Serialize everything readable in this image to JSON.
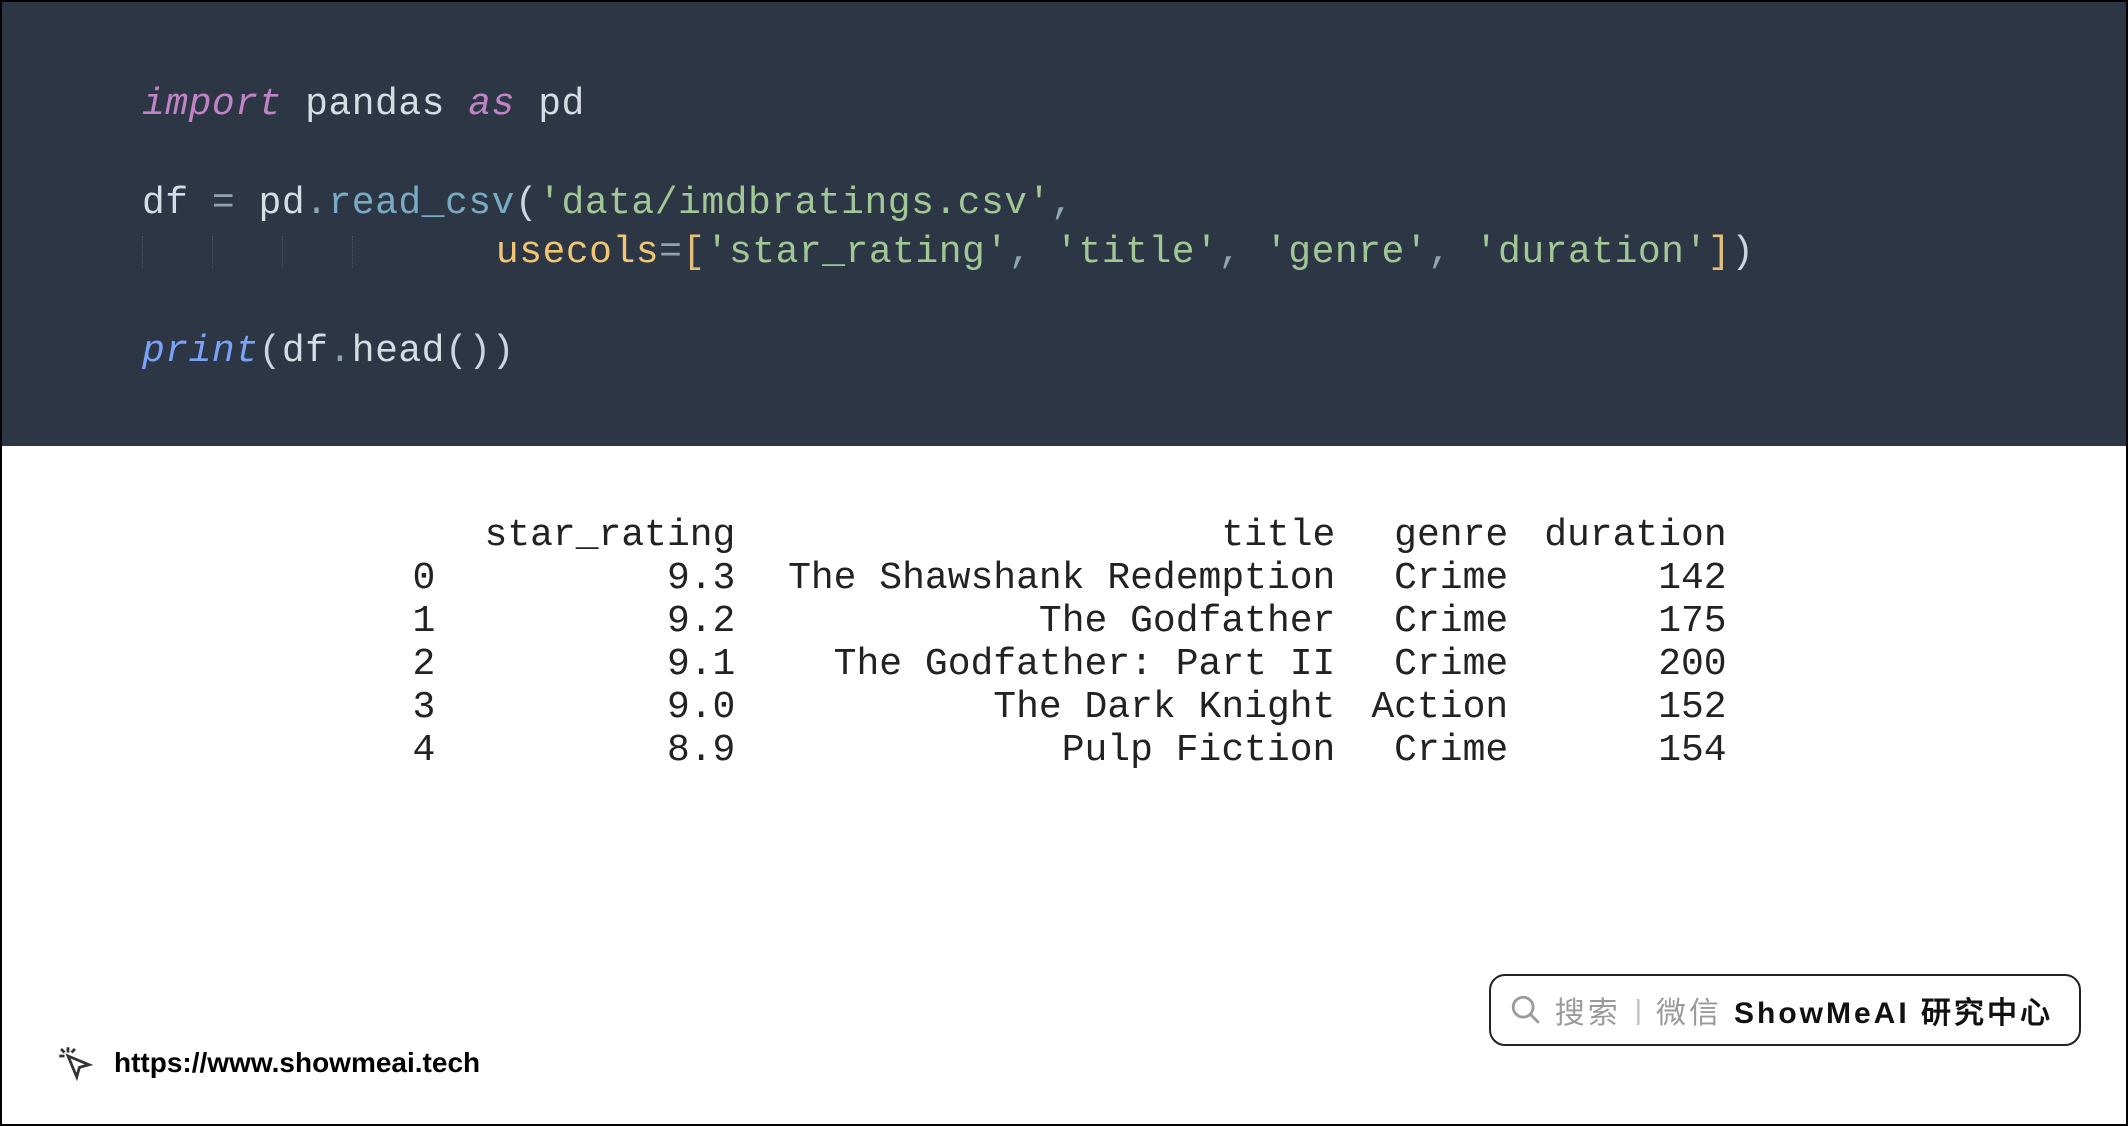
{
  "code": {
    "l1": {
      "kw1": "import",
      "mod": "pandas",
      "kw2": "as",
      "alias": "pd"
    },
    "l3": {
      "lhs": "df",
      "eq": "=",
      "obj": "pd",
      "dot": ".",
      "fn": "read_csv",
      "open": "(",
      "arg1": "'data/imdbratings.csv'",
      "comma": ","
    },
    "l4": {
      "param": "usecols",
      "eq2": "=",
      "lb": "[",
      "c1": "'star_rating'",
      "sep1": ", ",
      "c2": "'title'",
      "sep2": ", ",
      "c3": "'genre'",
      "sep3": ", ",
      "c4": "'duration'",
      "rb": "]",
      "close": ")"
    },
    "l6": {
      "print": "print",
      "open": "(",
      "obj": "df",
      "dot": ".",
      "fn": "head",
      "open2": "(",
      "close2": ")",
      "close": ")"
    }
  },
  "output": {
    "headers": {
      "idx": "",
      "c0": "star_rating",
      "c1": "title",
      "c2": "genre",
      "c3": "duration"
    },
    "rows": [
      {
        "idx": "0",
        "star_rating": "9.3",
        "title": "The Shawshank Redemption",
        "genre": "Crime",
        "duration": "142"
      },
      {
        "idx": "1",
        "star_rating": "9.2",
        "title": "The Godfather",
        "genre": "Crime",
        "duration": "175"
      },
      {
        "idx": "2",
        "star_rating": "9.1",
        "title": "The Godfather: Part II",
        "genre": "Crime",
        "duration": "200"
      },
      {
        "idx": "3",
        "star_rating": "9.0",
        "title": "The Dark Knight",
        "genre": "Action",
        "duration": "152"
      },
      {
        "idx": "4",
        "star_rating": "8.9",
        "title": "Pulp Fiction",
        "genre": "Crime",
        "duration": "154"
      }
    ]
  },
  "badge": {
    "search_label": "搜索",
    "wechat_label": "微信",
    "brand": "ShowMeAI 研究中心"
  },
  "footer": {
    "url": "https://www.showmeai.tech"
  }
}
